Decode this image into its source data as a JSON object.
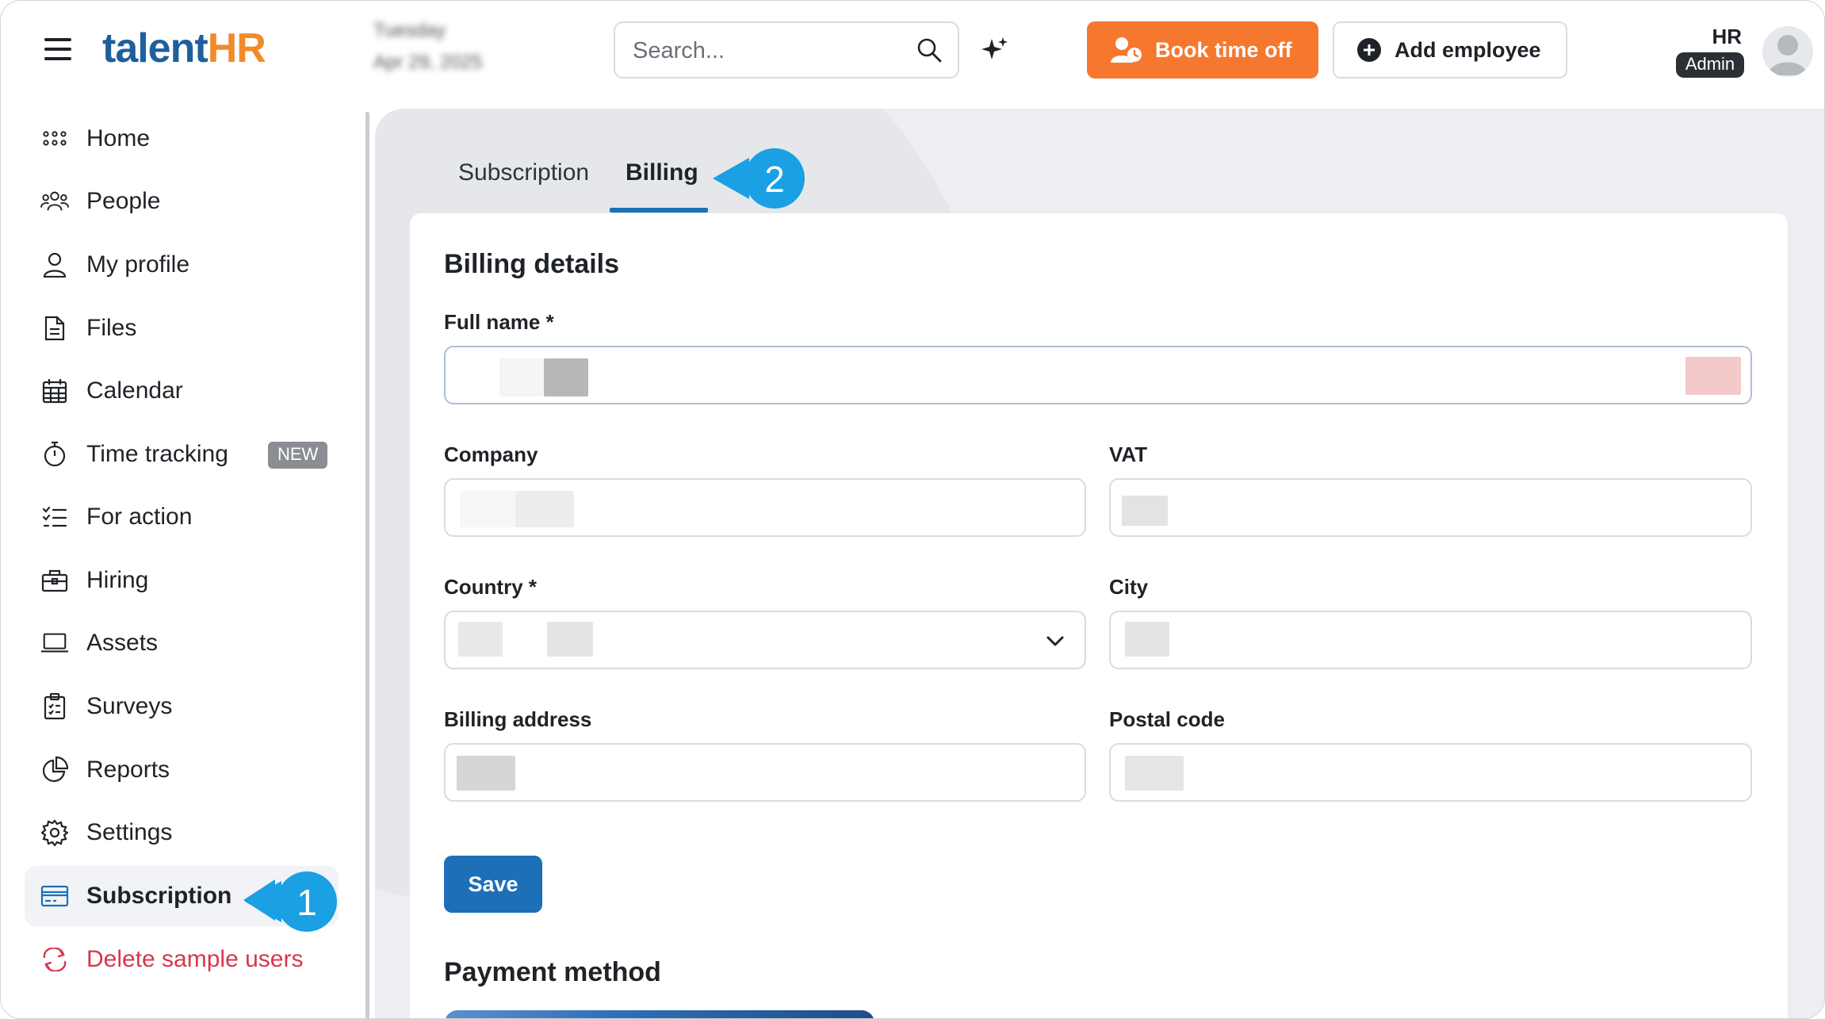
{
  "header": {
    "logo_part1": "talent",
    "logo_part2": "HR",
    "date_line1": "Tuesday",
    "date_line2": "Apr 29, 2025",
    "search_placeholder": "Search...",
    "book_time_off": "Book time off",
    "add_employee": "Add employee",
    "user_initials": "HR",
    "user_role": "Admin"
  },
  "sidebar": {
    "items": [
      {
        "label": "Home",
        "icon": "grid-icon"
      },
      {
        "label": "People",
        "icon": "people-icon"
      },
      {
        "label": "My profile",
        "icon": "user-icon"
      },
      {
        "label": "Files",
        "icon": "file-icon"
      },
      {
        "label": "Calendar",
        "icon": "calendar-icon"
      },
      {
        "label": "Time tracking",
        "icon": "stopwatch-icon",
        "badge": "NEW"
      },
      {
        "label": "For action",
        "icon": "checklist-icon"
      },
      {
        "label": "Hiring",
        "icon": "briefcase-icon"
      },
      {
        "label": "Assets",
        "icon": "laptop-icon"
      },
      {
        "label": "Surveys",
        "icon": "clipboard-icon"
      },
      {
        "label": "Reports",
        "icon": "pie-chart-icon"
      },
      {
        "label": "Settings",
        "icon": "gear-icon"
      },
      {
        "label": "Subscription",
        "icon": "credit-card-icon",
        "active": true
      },
      {
        "label": "Delete sample users",
        "icon": "refresh-icon",
        "danger": true
      }
    ]
  },
  "callouts": {
    "step1": "1",
    "step2": "2"
  },
  "tabs": [
    {
      "label": "Subscription",
      "active": false
    },
    {
      "label": "Billing",
      "active": true
    }
  ],
  "billing": {
    "title": "Billing details",
    "full_name_label": "Full name *",
    "company_label": "Company",
    "vat_label": "VAT",
    "country_label": "Country *",
    "city_label": "City",
    "address_label": "Billing address",
    "postal_label": "Postal code",
    "save_label": "Save"
  },
  "payment": {
    "title": "Payment method"
  },
  "colors": {
    "brand_blue": "#1f5f9d",
    "brand_orange": "#f28a2a",
    "book_button": "#f6782e",
    "primary": "#1d6fb8",
    "callout": "#1aa0e3",
    "danger": "#d9364c"
  }
}
